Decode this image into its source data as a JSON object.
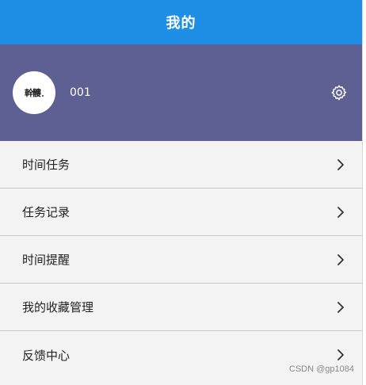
{
  "header": {
    "title": "我的"
  },
  "profile": {
    "avatar_text": "幹髏",
    "username": "001",
    "settings_icon": "gear-icon"
  },
  "menu": {
    "items": [
      {
        "label": "时间任务",
        "icon": "chevron-right-icon"
      },
      {
        "label": "任务记录",
        "icon": "chevron-right-icon"
      },
      {
        "label": "时间提醒",
        "icon": "chevron-right-icon"
      },
      {
        "label": "我的收藏管理",
        "icon": "chevron-right-icon"
      },
      {
        "label": "反馈中心",
        "icon": "chevron-right-icon"
      }
    ]
  },
  "watermark": "CSDN @gp1084",
  "colors": {
    "header_bg": "#1f8fe6",
    "profile_bg": "#5e5f93",
    "menu_bg": "#f3f3f3",
    "divider": "#c9c9c9"
  }
}
